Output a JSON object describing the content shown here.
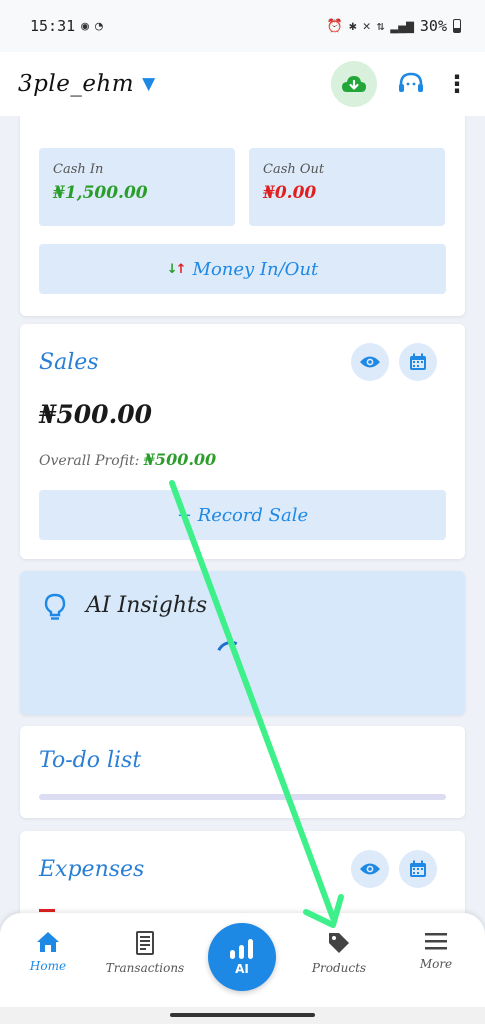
{
  "status_bar": {
    "time": "15:31",
    "battery": "30%"
  },
  "app_bar": {
    "title": "3ple_ehm"
  },
  "cash": {
    "in_label": "Cash In",
    "in_value": "₦1,500.00",
    "out_label": "Cash Out",
    "out_value": "₦0.00",
    "money_button": "Money In/Out"
  },
  "sales": {
    "title": "Sales",
    "amount": "₦500.00",
    "profit_label": "Overall Profit:",
    "profit_value": "₦500.00",
    "record_button": "+ Record Sale"
  },
  "ai_insights": {
    "title": "AI Insights"
  },
  "todo": {
    "title": "To-do list"
  },
  "expenses": {
    "title": "Expenses"
  },
  "bottom_nav": {
    "items": [
      {
        "label": "Home",
        "icon": "home-icon"
      },
      {
        "label": "Transactions",
        "icon": "receipt-icon"
      },
      {
        "label": "Products",
        "icon": "tag-icon"
      },
      {
        "label": "More",
        "icon": "menu-icon"
      }
    ],
    "fab_label": "AI"
  },
  "colors": {
    "accent": "#1e88e5",
    "positive": "#2a9d2a",
    "negative": "#e02020",
    "annotation_arrow": "#3ef08a"
  }
}
